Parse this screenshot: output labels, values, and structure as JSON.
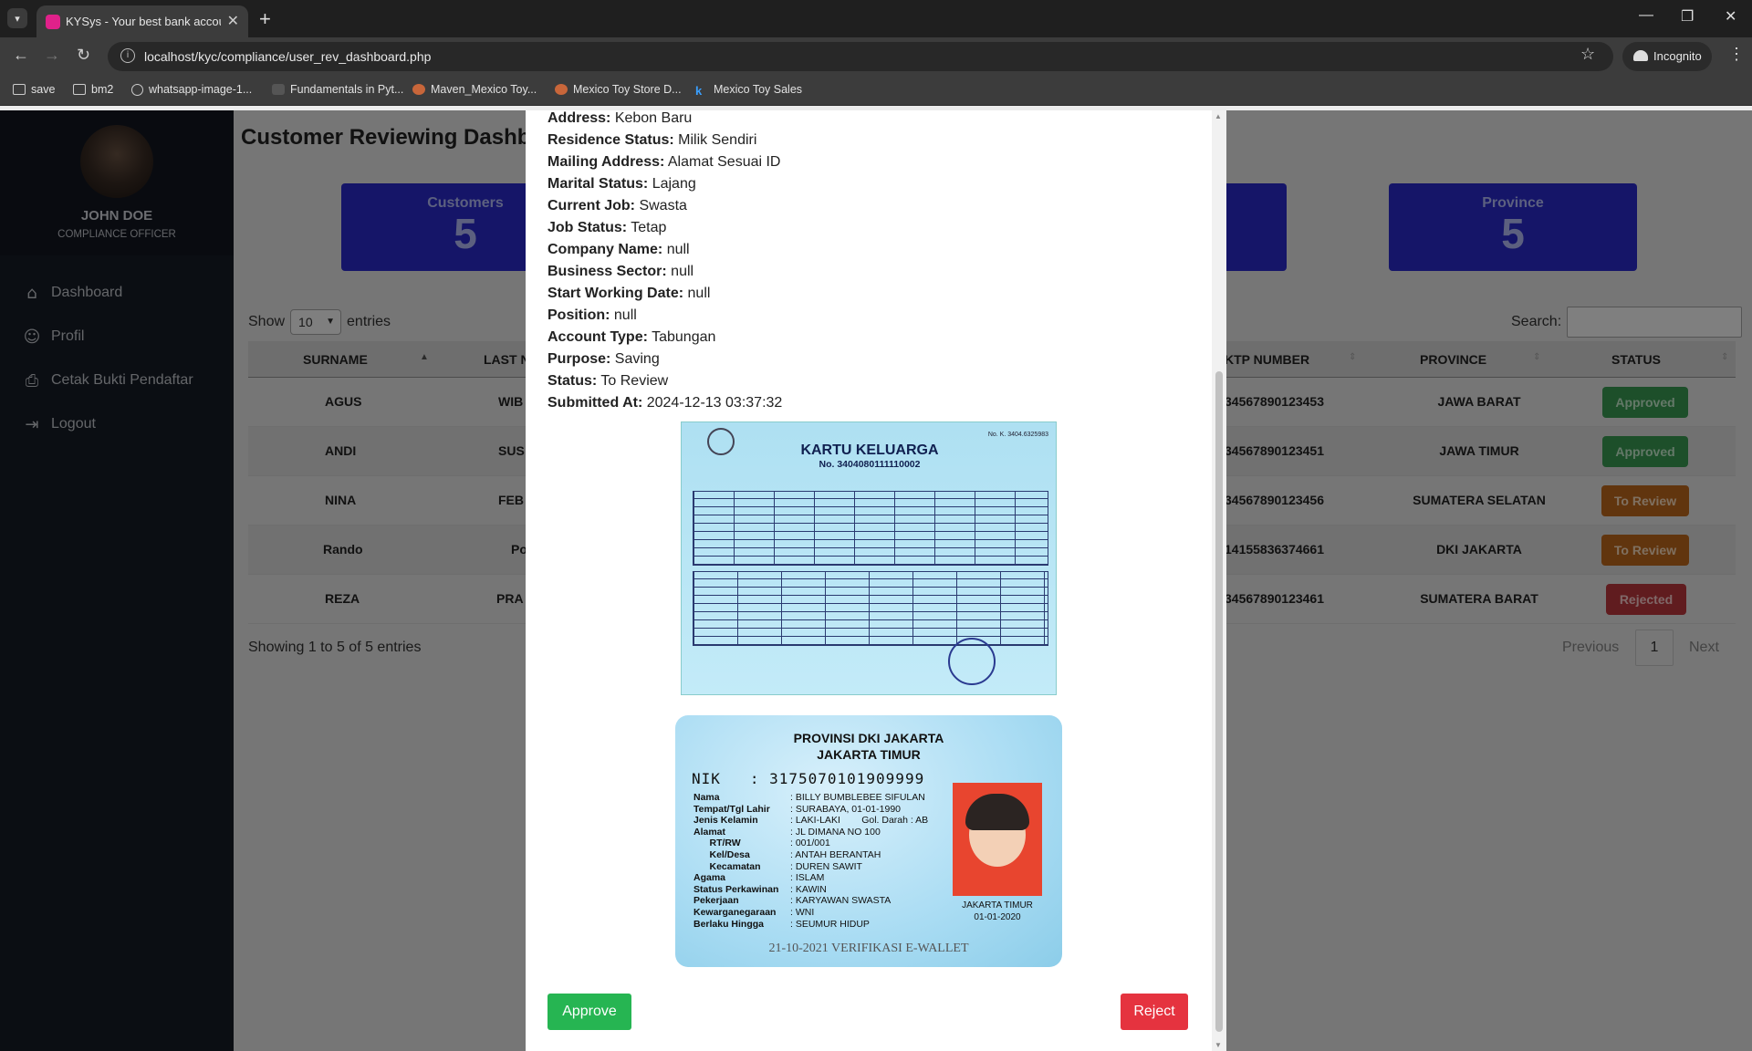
{
  "browser": {
    "tab_title": "KYSys - Your best bank account",
    "url": "localhost/kyc/compliance/user_rev_dashboard.php",
    "incognito_label": "Incognito",
    "bookmarks": [
      "save",
      "bm2",
      "whatsapp-image-1...",
      "Fundamentals in Pyt...",
      "Maven_Mexico Toy...",
      "Mexico Toy Store D...",
      "Mexico Toy Sales"
    ]
  },
  "sidebar": {
    "user_name": "JOHN DOE",
    "user_role": "COMPLIANCE OFFICER",
    "items": [
      {
        "label": "Dashboard",
        "icon": "home-icon"
      },
      {
        "label": "Profil",
        "icon": "user-icon"
      },
      {
        "label": "Cetak Bukti Pendaftar",
        "icon": "printer-icon"
      },
      {
        "label": "Logout",
        "icon": "logout-icon"
      }
    ]
  },
  "main": {
    "title": "Customer Reviewing Dashb",
    "stats": [
      {
        "label": "Customers",
        "value": "5"
      },
      {
        "label": "Province",
        "value": "5"
      }
    ],
    "show_label": "Show",
    "entries_value": "10",
    "entries_label": "entries",
    "search_label": "Search:",
    "columns": [
      "SURNAME",
      "LAST N",
      "KTP NUMBER",
      "PROVINCE",
      "STATUS"
    ],
    "rows": [
      {
        "surname": "AGUS",
        "last": "WIB",
        "ktp": "34567890123453",
        "province": "JAWA BARAT",
        "status": "Approved"
      },
      {
        "surname": "ANDI",
        "last": "SUS",
        "ktp": "34567890123451",
        "province": "JAWA TIMUR",
        "status": "Approved"
      },
      {
        "surname": "NINA",
        "last": "FEB",
        "ktp": "34567890123456",
        "province": "SUMATERA SELATAN",
        "status": "To Review"
      },
      {
        "surname": "Rando",
        "last": "Po",
        "ktp": "14155836374661",
        "province": "DKI JAKARTA",
        "status": "To Review"
      },
      {
        "surname": "REZA",
        "last": "PRA",
        "ktp": "34567890123461",
        "province": "SUMATERA BARAT",
        "status": "Rejected"
      }
    ],
    "showing_text": "Showing 1 to 5 of 5 entries",
    "previous": "Previous",
    "page": "1",
    "next": "Next"
  },
  "modal": {
    "fields": [
      {
        "label": "Address:",
        "value": "Kebon Baru"
      },
      {
        "label": "Residence Status:",
        "value": "Milik Sendiri"
      },
      {
        "label": "Mailing Address:",
        "value": "Alamat Sesuai ID"
      },
      {
        "label": "Marital Status:",
        "value": "Lajang"
      },
      {
        "label": "Current Job:",
        "value": "Swasta"
      },
      {
        "label": "Job Status:",
        "value": "Tetap"
      },
      {
        "label": "Company Name:",
        "value": "null"
      },
      {
        "label": "Business Sector:",
        "value": "null"
      },
      {
        "label": "Start Working Date:",
        "value": "null"
      },
      {
        "label": "Position:",
        "value": "null"
      },
      {
        "label": "Account Type:",
        "value": "Tabungan"
      },
      {
        "label": "Purpose:",
        "value": "Saving"
      },
      {
        "label": "Status:",
        "value": "To Review"
      },
      {
        "label": "Submitted At:",
        "value": "2024-12-13 03:37:32"
      }
    ],
    "kk": {
      "title": "KARTU KELUARGA",
      "number": "No. 3404080111110002",
      "corner": "No. K. 3404.6325983"
    },
    "ktp": {
      "province": "PROVINSI DKI JAKARTA",
      "city": "JAKARTA TIMUR",
      "nik_label": "NIK",
      "nik": ": 3175070101909999",
      "rows": [
        {
          "k": "Nama",
          "v": ": BILLY BUMBLEBEE SIFULAN"
        },
        {
          "k": "Tempat/Tgl Lahir",
          "v": ": SURABAYA, 01-01-1990"
        },
        {
          "k": "Jenis Kelamin",
          "v": ": LAKI-LAKI        Gol. Darah : AB"
        },
        {
          "k": "Alamat",
          "v": ": JL DIMANA NO 100"
        },
        {
          "k": "      RT/RW",
          "v": ": 001/001"
        },
        {
          "k": "      Kel/Desa",
          "v": ": ANTAH BERANTAH"
        },
        {
          "k": "      Kecamatan",
          "v": ": DUREN SAWIT"
        },
        {
          "k": "Agama",
          "v": ": ISLAM"
        },
        {
          "k": "Status Perkawinan",
          "v": ": KAWIN"
        },
        {
          "k": "Pekerjaan",
          "v": ": KARYAWAN SWASTA"
        },
        {
          "k": "Kewarganegaraan",
          "v": ": WNI"
        },
        {
          "k": "Berlaku Hingga",
          "v": ": SEUMUR HIDUP"
        }
      ],
      "place": "JAKARTA TIMUR",
      "date": "01-01-2020",
      "bottom": "21-10-2021 VERIFIKASI E-WALLET"
    },
    "approve_label": "Approve",
    "reject_label": "Reject"
  }
}
